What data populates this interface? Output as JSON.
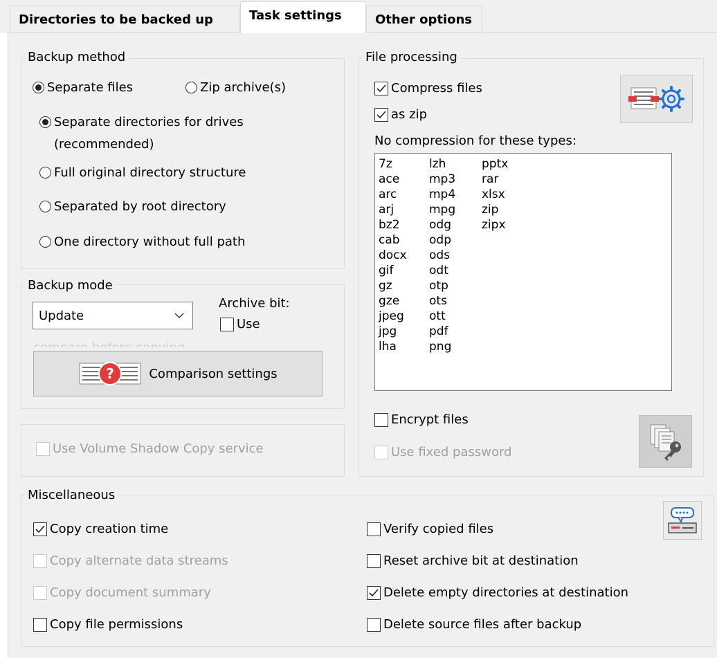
{
  "tabs": [
    {
      "label": "Directories to be backed up"
    },
    {
      "label": "Task settings"
    },
    {
      "label": "Other options"
    }
  ],
  "backup_method": {
    "title": "Backup method",
    "separate_files": "Separate files",
    "zip_archives": "Zip archive(s)",
    "separate_dirs_line1": "Separate directories for drives",
    "separate_dirs_line2": "(recommended)",
    "full_structure": "Full original directory structure",
    "by_root": "Separated by root directory",
    "one_dir": "One directory without full path"
  },
  "backup_mode": {
    "title": "Backup mode",
    "mode_value": "Update",
    "archive_bit_label": "Archive bit:",
    "use_label": "Use",
    "hidden_text": "compare before copying",
    "comparison_button": "Comparison settings"
  },
  "vss": {
    "label": "Use Volume Shadow Copy service"
  },
  "file_processing": {
    "title": "File processing",
    "compress": "Compress files",
    "as_zip": "as zip",
    "no_compression_label": "No compression for these types:",
    "types_col1": [
      "7z",
      "ace",
      "arc",
      "arj",
      "bz2",
      "cab",
      "docx",
      "gif",
      "gz",
      "gze",
      "jpeg",
      "jpg",
      "lha"
    ],
    "types_col2": [
      "lzh",
      "mp3",
      "mp4",
      "mpg",
      "odg",
      "odp",
      "ods",
      "odt",
      "otp",
      "ots",
      "ott",
      "pdf",
      "png"
    ],
    "types_col3": [
      "pptx",
      "rar",
      "xlsx",
      "zip",
      "zipx"
    ],
    "encrypt": "Encrypt files",
    "fixed_password": "Use fixed password"
  },
  "misc": {
    "title": "Miscellaneous",
    "copy_creation_time": "Copy creation time",
    "copy_ads": "Copy alternate data streams",
    "copy_summary": "Copy document summary",
    "copy_permissions": "Copy file permissions",
    "verify": "Verify copied files",
    "reset_archive": "Reset archive bit at destination",
    "delete_empty": "Delete empty directories at destination",
    "delete_source": "Delete source files after backup"
  },
  "colors": {
    "accent_blue": "#1e73d7",
    "help_red": "#e03a3a",
    "panel_bg": "#f0f0f0"
  }
}
